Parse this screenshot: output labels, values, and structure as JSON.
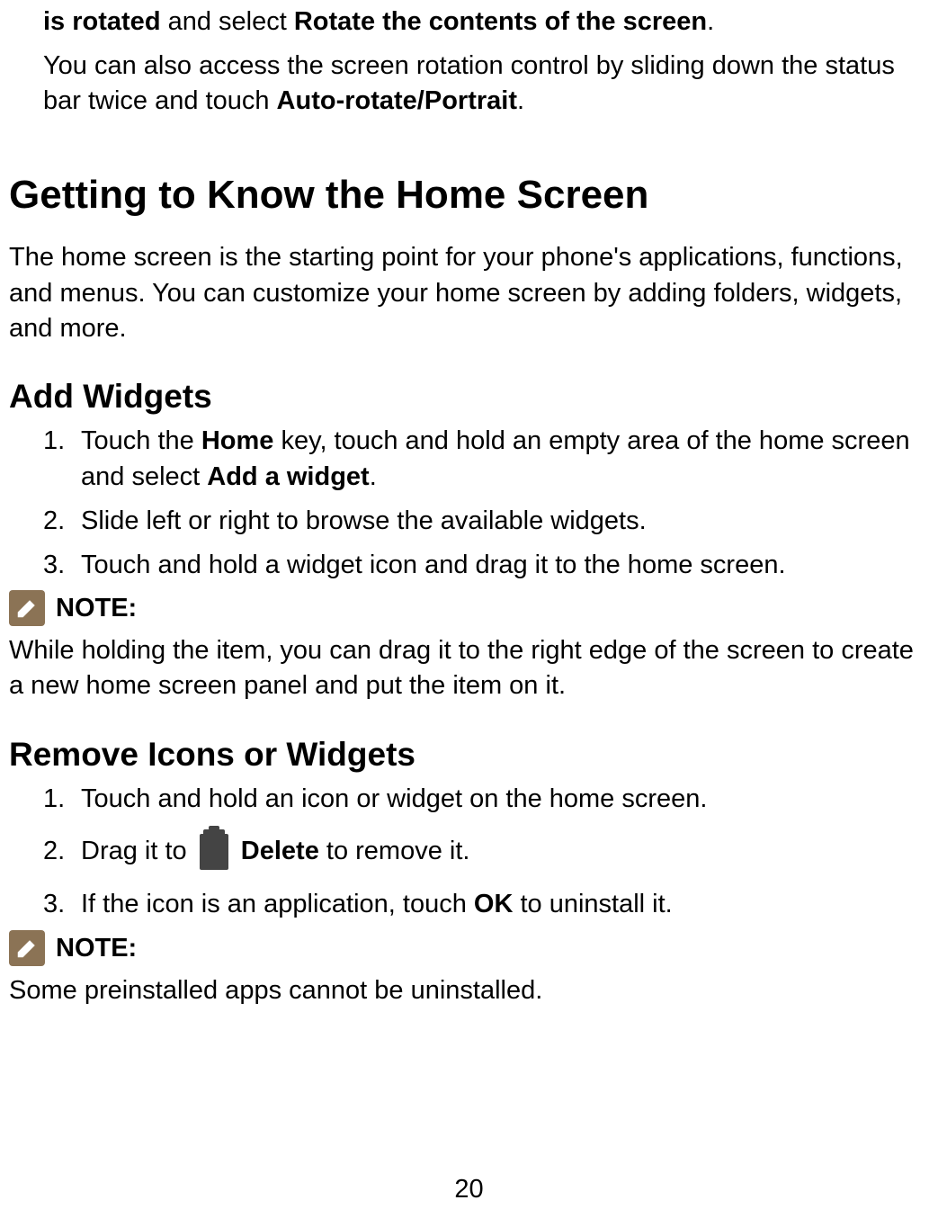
{
  "topPara": {
    "line1_prefix_bold": "is rotated",
    "line1_mid": " and select ",
    "line1_suffix_bold": "Rotate the contents of the screen",
    "line1_end": ".",
    "line2_start": "You can also access the screen rotation control by sliding down the status bar twice and touch ",
    "line2_bold": "Auto-rotate/Portrait",
    "line2_end": "."
  },
  "h1": "Getting to Know the Home Screen",
  "intro": "The home screen is the starting point for your phone's applications, functions, and menus. You can customize your home screen by adding folders, widgets, and more.",
  "addWidgets": {
    "heading": "Add Widgets",
    "step1": {
      "num": "1.",
      "pre": "Touch the ",
      "bold1": "Home",
      "mid": " key, touch and hold an empty area of the home screen and select ",
      "bold2": "Add a widget",
      "end": "."
    },
    "step2": {
      "num": "2.",
      "text": "Slide left or right to browse the available widgets."
    },
    "step3": {
      "num": "3.",
      "text": "Touch and hold a widget icon and drag it to the home screen."
    },
    "noteLabel": " NOTE:",
    "noteText": "While holding the item, you can drag it to the right edge of the screen to create a new home screen panel and put the item on it."
  },
  "removeIcons": {
    "heading": "Remove Icons or Widgets",
    "step1": {
      "num": "1.",
      "text": "Touch and hold an icon or widget on the home screen."
    },
    "step2": {
      "num": "2.",
      "pre": "Drag it to ",
      "bold": "Delete",
      "end": " to remove it."
    },
    "step3": {
      "num": "3.",
      "pre": "If the icon is an application, touch ",
      "bold": "OK",
      "end": " to uninstall it."
    },
    "noteLabel": " NOTE:",
    "noteText": "Some preinstalled apps cannot be uninstalled."
  },
  "pageNumber": "20"
}
